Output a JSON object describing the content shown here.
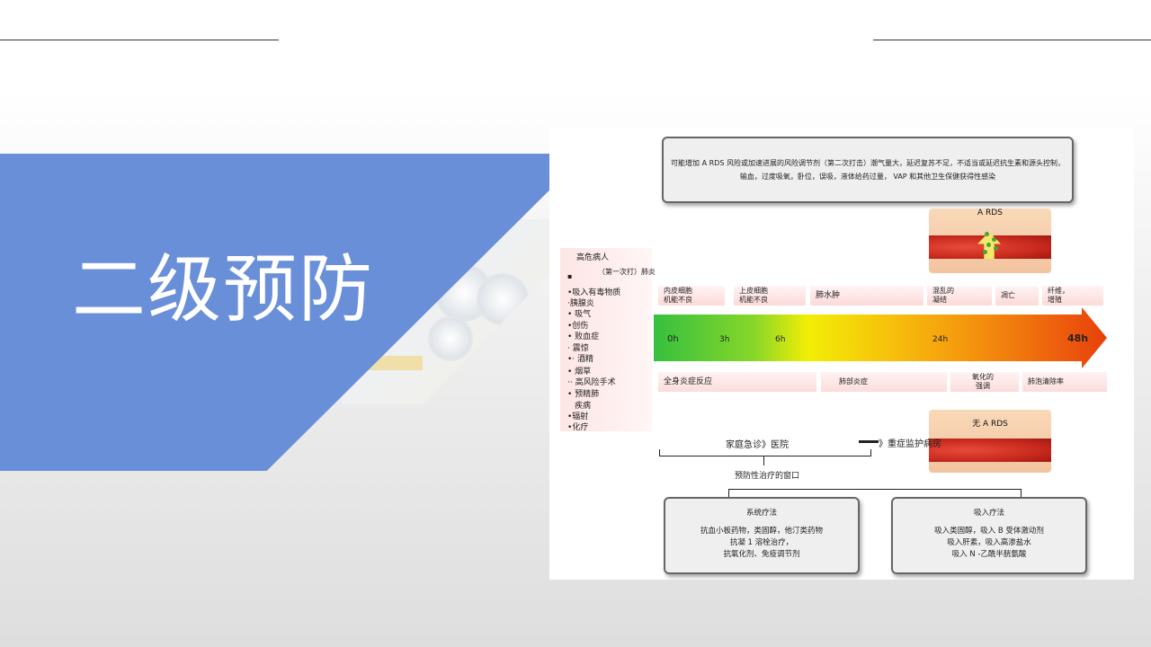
{
  "slide": {
    "title": "二级预防"
  },
  "diagram": {
    "risk_factors_line1": "可能增加 A RDS 风险或加速进展的风险调节剂（第二次打击）潮气量大，延迟复苏不足，不适当或延迟抗生素和源头控制，",
    "risk_factors_line2": "输血，过度吸氧，卧位，误吸，液体给药过量， VAP 和其他卫生保健获得性感染",
    "lung_top_label": "A RDS",
    "lung_bottom_label": "无 A RDS",
    "high_risk_title": "高危病人",
    "first_hit_label": "（第一次打）肺炎",
    "bullet_blank": "▪",
    "conditions": [
      "•吸入有毒物质",
      "·胰腺炎",
      "• 吸气",
      "•创伤",
      "• 败血症",
      "· 震惊",
      "•· 酒精",
      "• 烟草",
      "·· 高风险手术",
      "• 预精肺",
      "疾病",
      "•辐射",
      "•化疗"
    ],
    "top_phases": [
      "内皮细胞机能不良",
      "上皮细胞机能不良",
      "肺水肿",
      "混乱的凝结",
      "凋亡",
      "纤维，增殖"
    ],
    "top_phases_split": [
      [
        "内皮细胞",
        "机能不良"
      ],
      [
        "上皮细胞",
        "机能不良"
      ],
      [
        "肺水肿",
        ""
      ],
      [
        "混乱的",
        "凝结"
      ],
      [
        "凋亡",
        ""
      ],
      [
        "纤维，",
        "增殖"
      ]
    ],
    "time_ticks": [
      "0h",
      "3h",
      "6h",
      "24h",
      "48h"
    ],
    "bottom_phases": [
      "全身炎症反应",
      "肺部炎症",
      "氧化的强调",
      "肺泡清除率"
    ],
    "bottom_phase_oxid": [
      "氧化的",
      "强调"
    ],
    "care_setting": "家庭急诊》医院",
    "icu_label": "》重症监护病房",
    "window_label": "预防性治疗的窗口",
    "systemic": {
      "title": "系统疗法",
      "lines": [
        "抗血小板药物，类固醇，他汀类药物",
        "抗凝 1 溶栓治疗，",
        "抗氧化剂、免疫调节剂"
      ]
    },
    "inhaled": {
      "title": "吸入疗法",
      "lines": [
        "吸入类固醇，吸入 B 受体激动剂",
        "吸入肝素，吸入高渗盐水",
        "吸入 N -乙酰半胱氨酸"
      ]
    }
  },
  "colors": {
    "banner": "#6a8fd9",
    "arrow_start": "#36c040",
    "arrow_end": "#e8400c"
  }
}
